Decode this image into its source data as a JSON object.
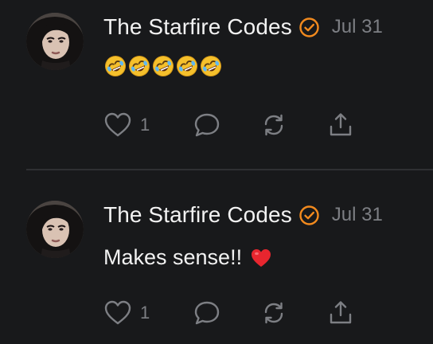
{
  "posts": [
    {
      "author": "The Starfire Codes",
      "date": "Jul 31",
      "body_text": "",
      "body_emoji": [
        "rofl",
        "rofl",
        "rofl",
        "rofl",
        "rofl"
      ],
      "like_count": "1"
    },
    {
      "author": "The Starfire Codes",
      "date": "Jul 31",
      "body_text": "Makes sense!!",
      "body_emoji": [
        "red-heart"
      ],
      "like_count": "1"
    }
  ],
  "icons": {
    "verified": "verified-check-icon",
    "like": "heart-outline-icon",
    "reply": "speech-bubble-icon",
    "repost": "repost-arrows-icon",
    "share": "share-upload-icon"
  },
  "colors": {
    "background": "#18191b",
    "text": "#f2f2f2",
    "muted": "#7d7f84",
    "verified": "#f28a1e",
    "divider": "#2f3033"
  }
}
